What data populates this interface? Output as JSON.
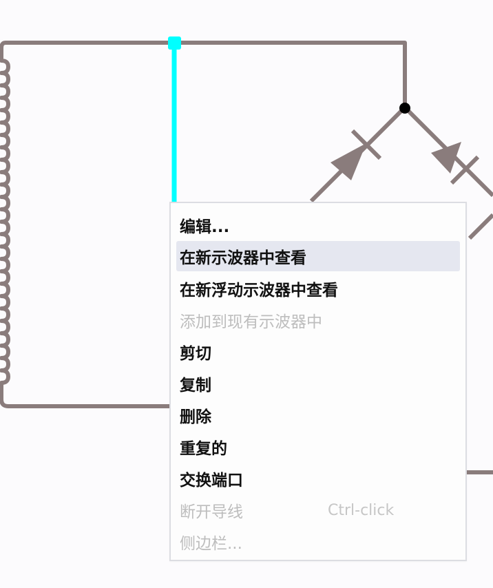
{
  "context_menu": {
    "items": [
      {
        "label": "编辑...",
        "enabled": true,
        "highlighted": false
      },
      {
        "label": "在新示波器中查看",
        "enabled": true,
        "highlighted": true
      },
      {
        "label": "在新浮动示波器中查看",
        "enabled": true,
        "highlighted": false
      },
      {
        "label": "添加到现有示波器中",
        "enabled": false,
        "highlighted": false
      },
      {
        "label": "剪切",
        "enabled": true,
        "highlighted": false
      },
      {
        "label": "复制",
        "enabled": true,
        "highlighted": false
      },
      {
        "label": "删除",
        "enabled": true,
        "highlighted": false
      },
      {
        "label": "重复的",
        "enabled": true,
        "highlighted": false
      },
      {
        "label": "交换端口",
        "enabled": true,
        "highlighted": false
      },
      {
        "label": "断开导线",
        "enabled": false,
        "highlighted": false,
        "shortcut": "Ctrl-click"
      },
      {
        "label": "侧边栏...",
        "enabled": false,
        "highlighted": false
      }
    ]
  },
  "colors": {
    "wire": "#8a7c7c",
    "selected_wire": "#00ffff",
    "node": "#000000",
    "menu_highlight": "#e5e7f0"
  }
}
